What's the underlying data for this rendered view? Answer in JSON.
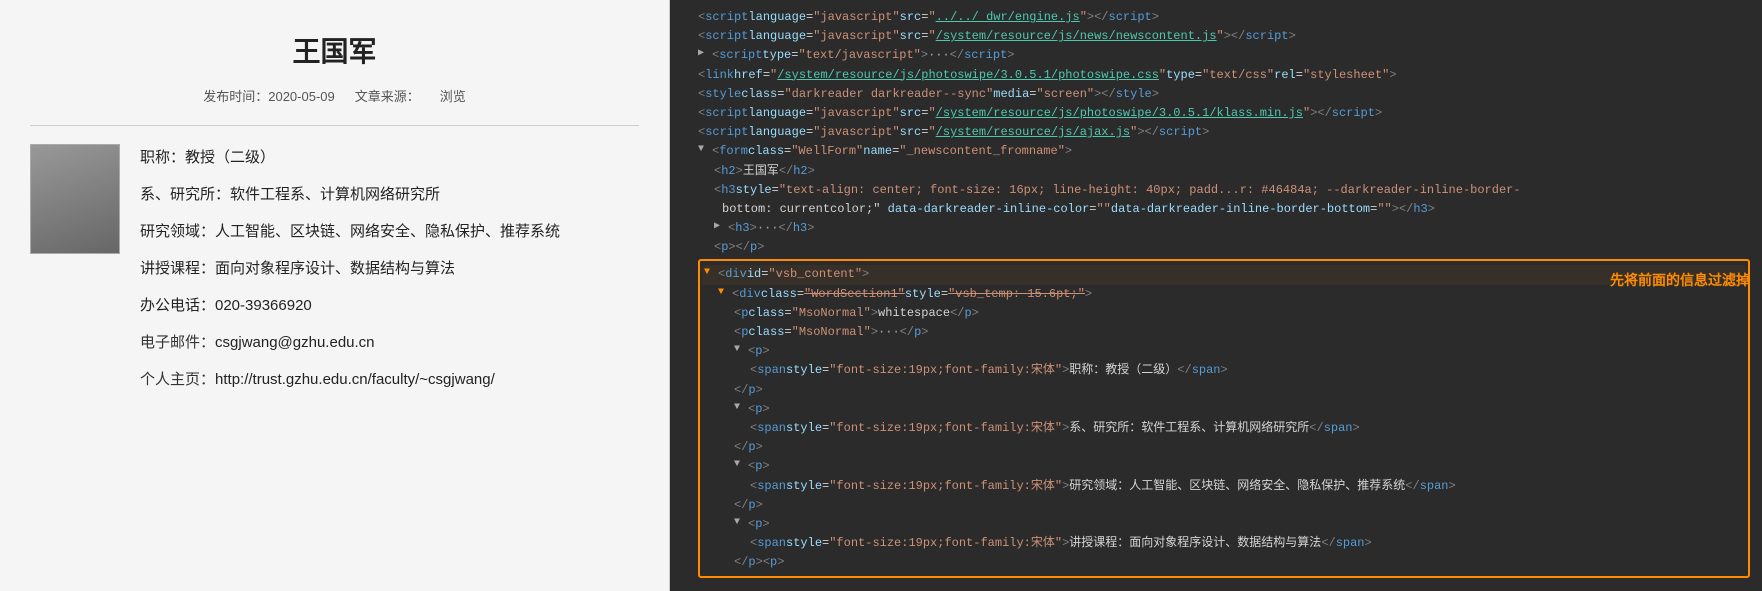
{
  "leftPanel": {
    "name": "王国军",
    "publishDate": "发布时间：2020-05-09",
    "articleSource": "文章来源：",
    "browserInfo": "浏览",
    "details": {
      "title": "职称：教授（二级）",
      "department": "系、研究所：软件工程系、计算机网络研究所",
      "research": "研究领域：人工智能、区块链、网络安全、隐私保护、推荐系统",
      "courses": "讲授课程：面向对象程序设计、数据结构与算法",
      "phone": "办公电话：020-39366920",
      "email_label": "电子邮件：",
      "email": "csgjwang@gzhu.edu.cn",
      "homepage_label": "个人主页：",
      "homepage": "http://trust.gzhu.edu.cn/faculty/~csgjwang/"
    }
  },
  "rightPanel": {
    "orangeLabel": "先将前面的信息过滤掉",
    "lines": [
      {
        "indent": 1,
        "content": "<script language=\"javascript\" src=\"../../ dwr/engine.js\"><\\/script>"
      },
      {
        "indent": 1,
        "content": "<script language=\"javascript\" src=\"/system/resource/js/news/newscontent.js\"><\\/script>"
      },
      {
        "indent": 1,
        "content": "<script type=\"text/javascript\"> ··· <\\/script>"
      },
      {
        "indent": 1,
        "content": "<link href=\"/system/resource/js/photoswipe/3.0.5.1/photoswipe.css\" type=\"text/css\" rel=\"stylesheet\">"
      },
      {
        "indent": 1,
        "content": "<style class=\"darkreader darkreader--sync\" media=\"screen\"><\\/style>"
      },
      {
        "indent": 1,
        "content": "<script language=\"javascript\" src=\"/system/resource/js/photoswipe/3.0.5.1/klass.min.js\"><\\/script>"
      },
      {
        "indent": 1,
        "content": "<script language=\"javascript\" src=\"/system/resource/js/ajax.js\"><\\/script>"
      },
      {
        "indent": 1,
        "content": "<form class=\"WellForm\" name=\"_newscontent_fromname\">"
      },
      {
        "indent": 2,
        "content": "<h2>王国军<\\/h2>"
      },
      {
        "indent": 2,
        "content": "<h3 style=\"text-align: center; font-size: 16px; line-height: 40px; padd...r: #46484a; --darkreader-inline-border-"
      },
      {
        "indent": 2,
        "content": "bottom: currentcolor;\" data-darkreader-inline-color=\"\" data-darkreader-inline-border-bottom=\"\"><\\/h3>"
      },
      {
        "indent": 2,
        "content": "<h3> ··· <\\/h3>"
      },
      {
        "indent": 2,
        "content": "<p><\\/p>"
      },
      {
        "indent": 2,
        "arrow": "▼",
        "content": "<div id=\"vsb_content\">",
        "highlighted": true
      },
      {
        "indent": 3,
        "arrow": "▼",
        "content": "<div class=\"WordSection1\" style=\"vsb_temp: 15.6pt;\">",
        "highlighted": true
      },
      {
        "indent": 4,
        "content": "<p class=\"MsoNormal\"> whitespace <\\/p>"
      },
      {
        "indent": 4,
        "content": "<p class=\"MsoNormal\"> ··· <\\/p>"
      },
      {
        "indent": 4,
        "arrow": "▼",
        "content": "<p>"
      },
      {
        "indent": 5,
        "content": "<span style=\"font-size:19px;font-family:宋体\">职称：教授（二级）<\\/span>"
      },
      {
        "indent": 4,
        "content": "<\\/p>"
      },
      {
        "indent": 4,
        "arrow": "▼",
        "content": "<p>"
      },
      {
        "indent": 5,
        "content": "<span style=\"font-size:19px;font-family:宋体\">系、研究所：软件工程系、计算机网络研究所<\\/span>"
      },
      {
        "indent": 4,
        "content": "<\\/p>"
      },
      {
        "indent": 4,
        "arrow": "▼",
        "content": "<p>"
      },
      {
        "indent": 5,
        "content": "<span style=\"font-size:19px;font-family:宋体\">研究领域：人工智能、区块链、网络安全、隐私保护、推荐系统<\\/span>"
      },
      {
        "indent": 4,
        "content": "<\\/p>"
      },
      {
        "indent": 4,
        "arrow": "▼",
        "content": "<p>"
      },
      {
        "indent": 5,
        "content": "<span style=\"font-size:19px;font-family:宋体\">讲授课程：面向对象程序设计、数据结构与算法<\\/span>"
      },
      {
        "indent": 4,
        "content": "<\\/p><p>"
      }
    ]
  }
}
